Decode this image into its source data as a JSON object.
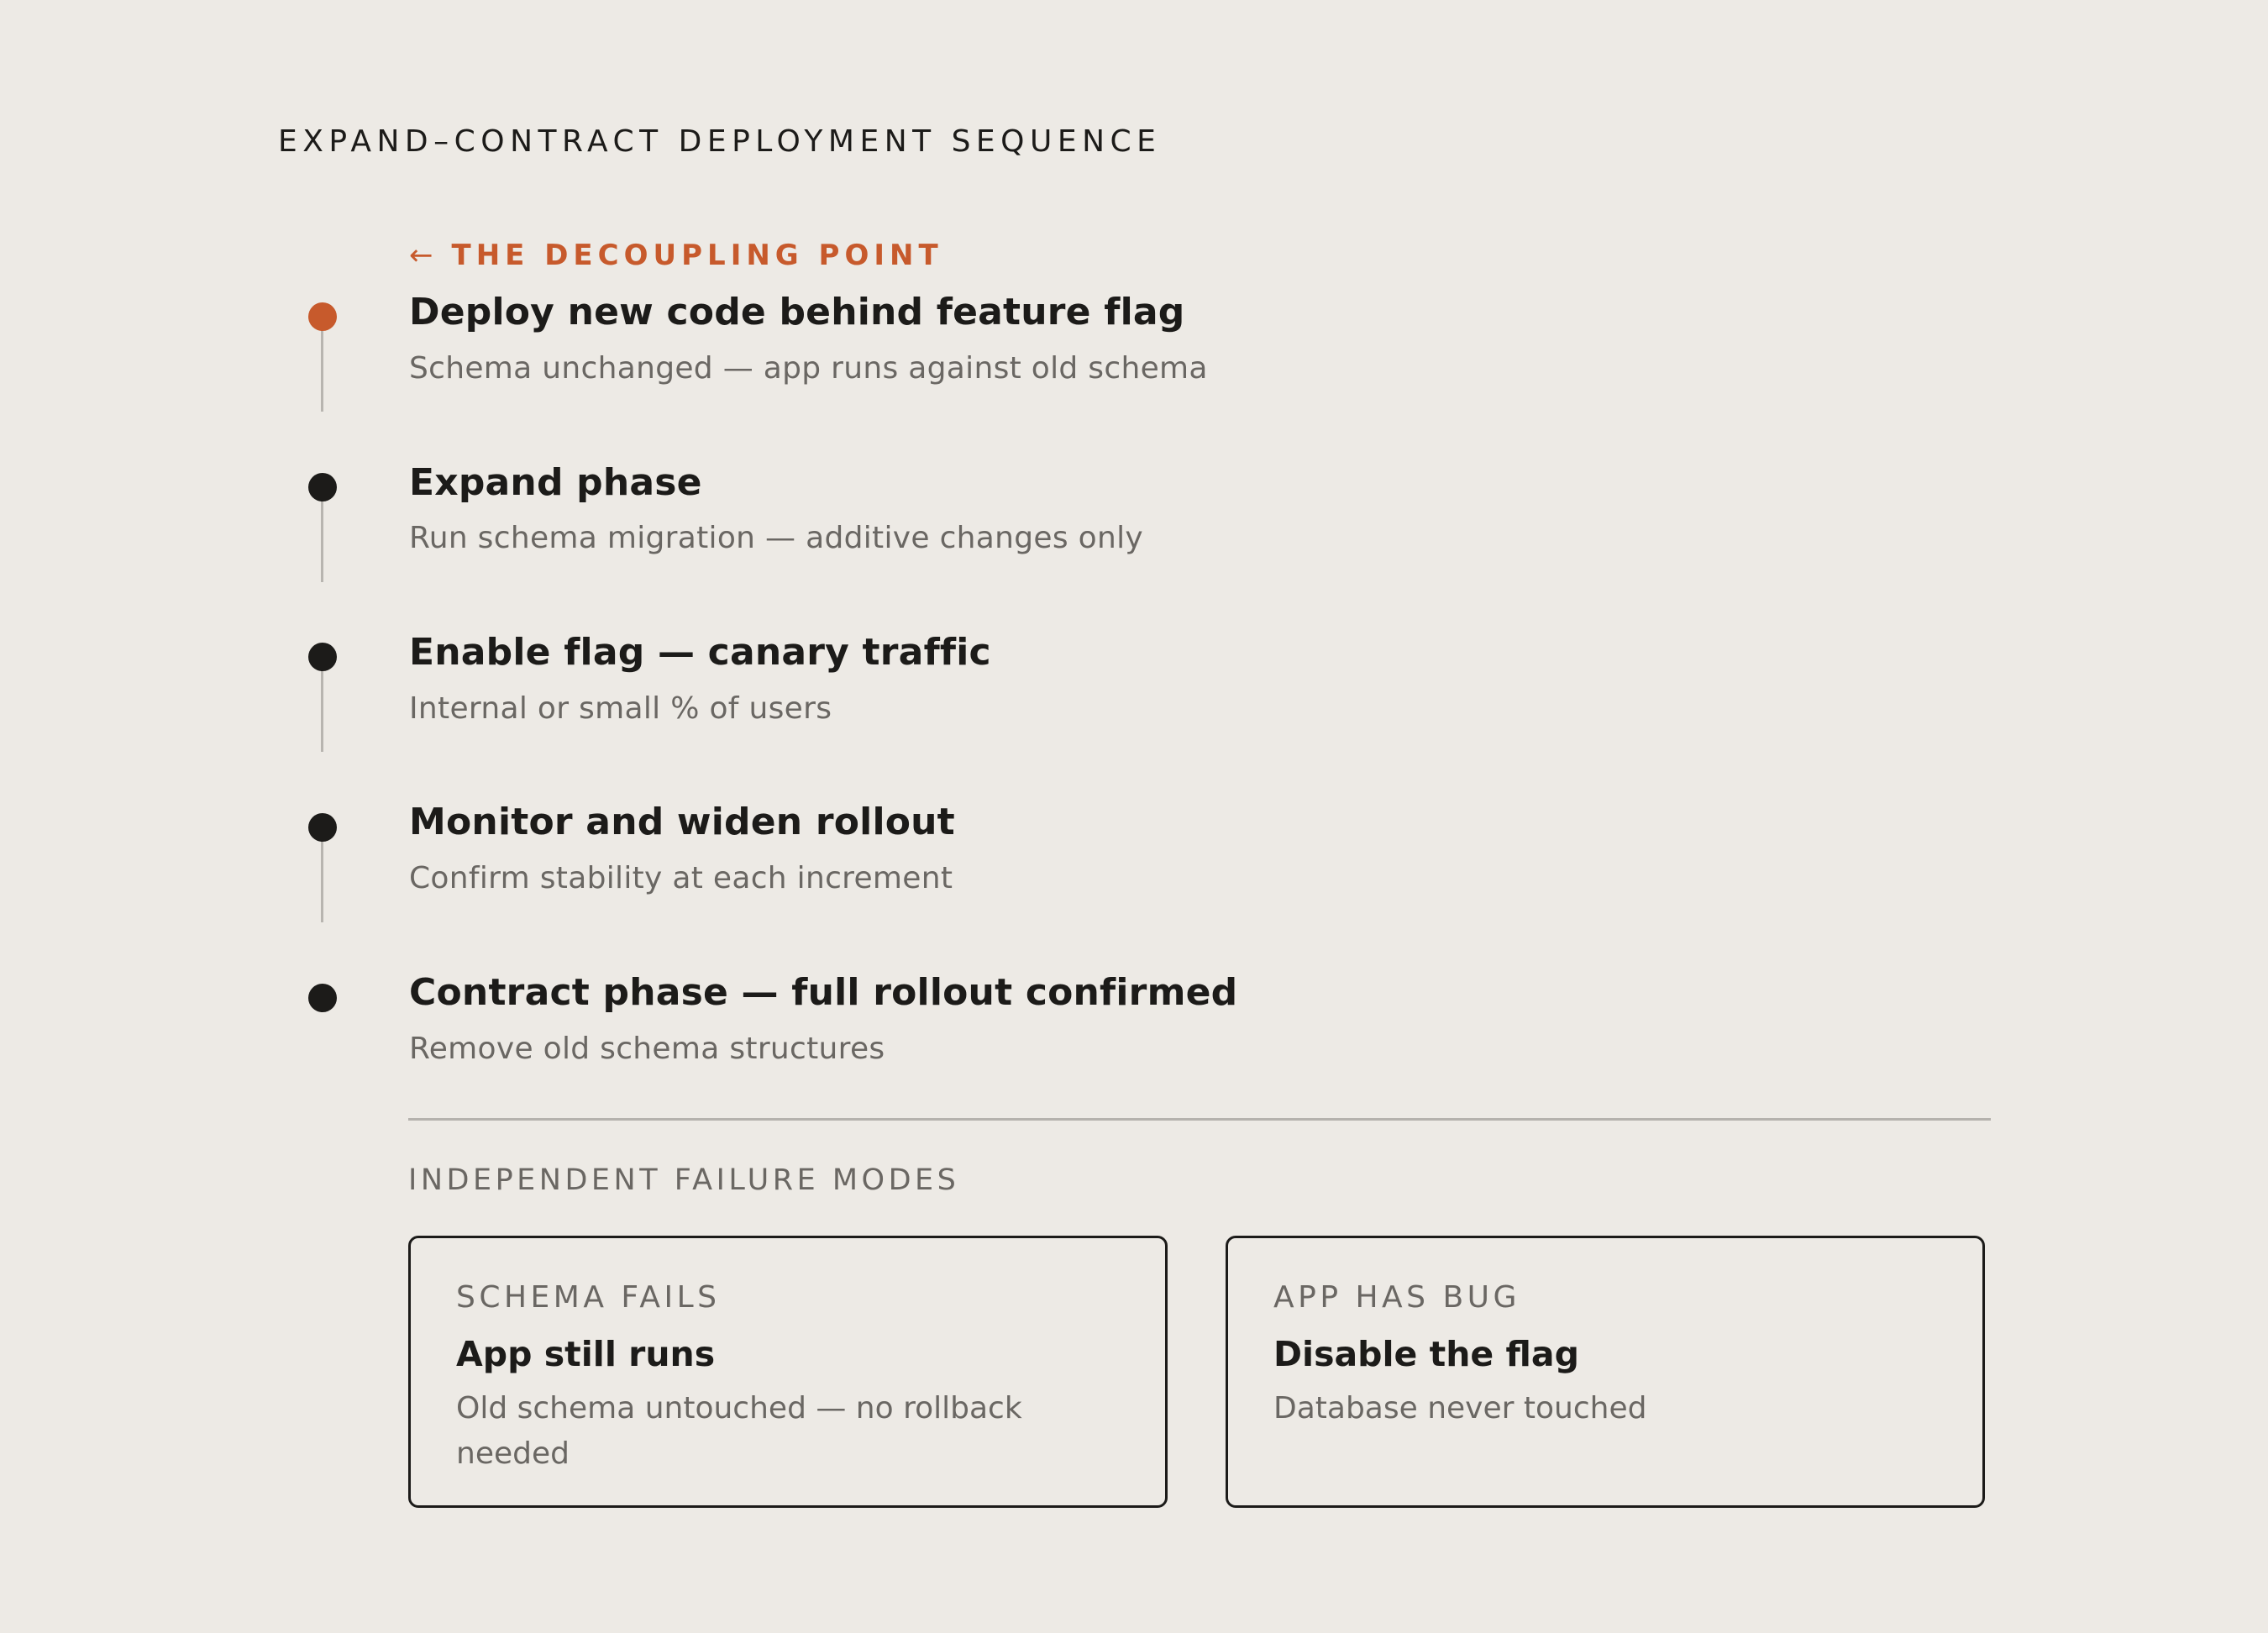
{
  "title": "EXPAND–CONTRACT DEPLOYMENT SEQUENCE",
  "callout": {
    "arrow": "←",
    "label": "THE DECOUPLING POINT",
    "color": "#c75a2c"
  },
  "steps": [
    {
      "title": "Deploy new code behind feature flag",
      "description": "Schema unchanged — app runs against old schema",
      "highlighted": true
    },
    {
      "title": "Expand phase",
      "description": "Run schema migration — additive changes only",
      "highlighted": false
    },
    {
      "title": "Enable flag — canary traffic",
      "description": "Internal or small % of users",
      "highlighted": false
    },
    {
      "title": "Monitor and widen rollout",
      "description": "Confirm stability at each increment",
      "highlighted": false
    },
    {
      "title": "Contract phase — full rollout confirmed",
      "description": "Remove old schema structures",
      "highlighted": false
    }
  ],
  "failure_modes": {
    "label": "INDEPENDENT FAILURE MODES",
    "cards": [
      {
        "label": "SCHEMA FAILS",
        "title": "App still runs",
        "description": "Old schema untouched — no rollback needed"
      },
      {
        "label": "APP HAS BUG",
        "title": "Disable the flag",
        "description": "Database never touched"
      }
    ]
  },
  "colors": {
    "background": "#edeae5",
    "accent": "#c75a2c",
    "text": "#1c1b19",
    "muted": "#6a6763"
  }
}
